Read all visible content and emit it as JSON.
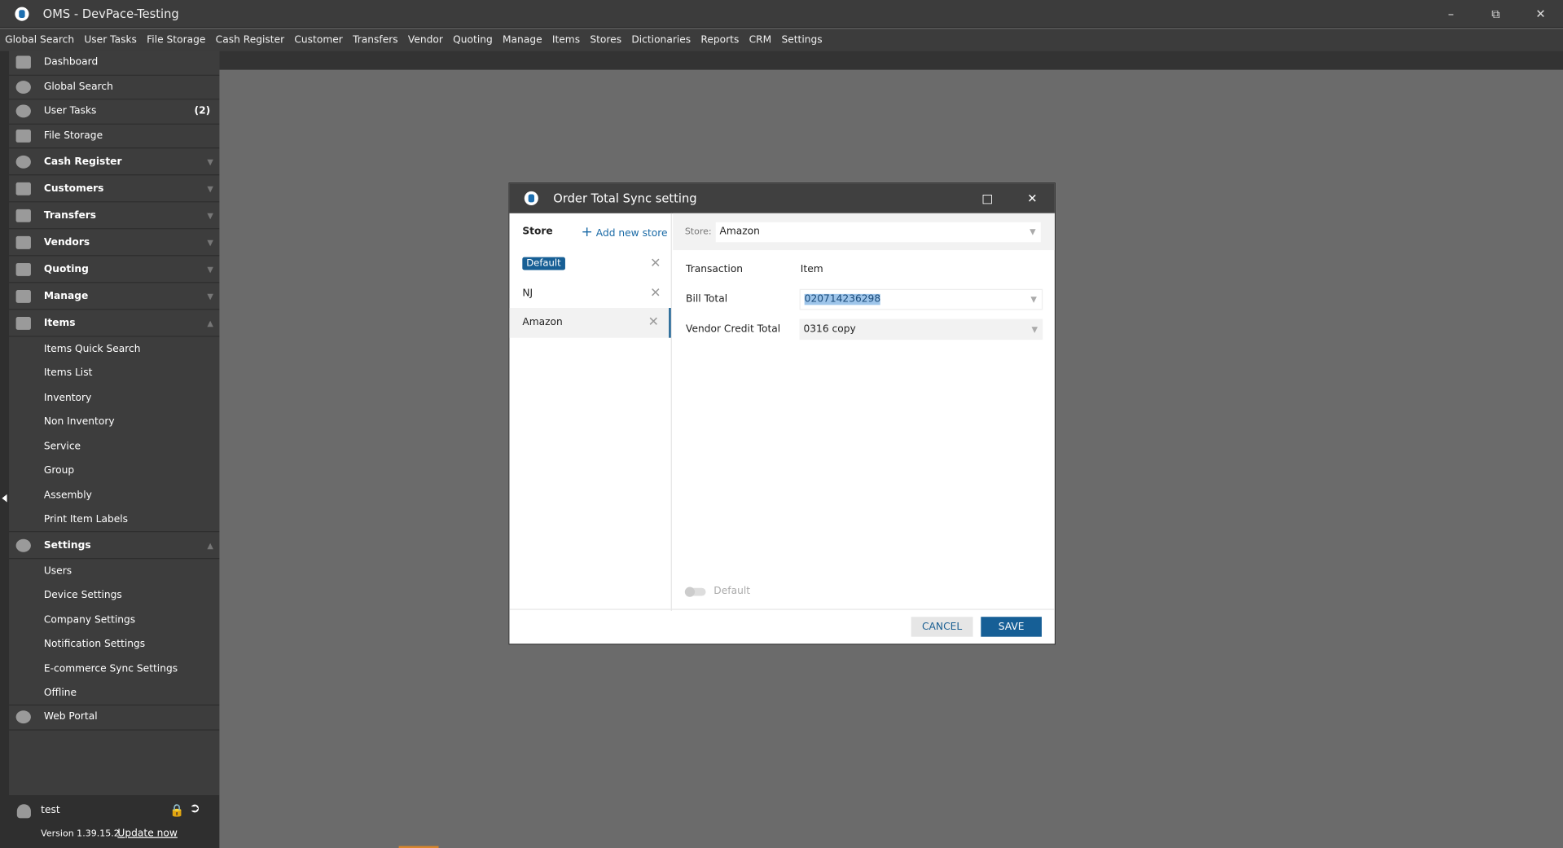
{
  "app": {
    "title": "OMS - DevPace-Testing",
    "window_controls": [
      "minimize",
      "restore",
      "close"
    ]
  },
  "menu": [
    "Global Search",
    "User Tasks",
    "File Storage",
    "Cash Register",
    "Customer",
    "Transfers",
    "Vendor",
    "Quoting",
    "Manage",
    "Items",
    "Stores",
    "Dictionaries",
    "Reports",
    "CRM",
    "Settings"
  ],
  "sidebar": {
    "items": [
      {
        "label": "Dashboard",
        "icon": "dashboard-icon"
      },
      {
        "label": "Global Search",
        "icon": "search-icon"
      },
      {
        "label": "User Tasks",
        "icon": "check-circle-icon",
        "badge": "(2)"
      },
      {
        "label": "File Storage",
        "icon": "folder-icon"
      },
      {
        "label": "Cash Register",
        "icon": "dollar-icon",
        "expandable": true
      },
      {
        "label": "Customers",
        "icon": "customer-icon",
        "expandable": true
      },
      {
        "label": "Transfers",
        "icon": "transfer-icon",
        "expandable": true
      },
      {
        "label": "Vendors",
        "icon": "vendor-icon",
        "expandable": true
      },
      {
        "label": "Quoting",
        "icon": "quoting-icon",
        "expandable": true
      },
      {
        "label": "Manage",
        "icon": "manage-icon",
        "expandable": true
      }
    ],
    "items_section": {
      "label": "Items",
      "children": [
        "Items Quick Search",
        "Items List",
        "Inventory",
        "Non Inventory",
        "Service",
        "Group",
        "Assembly",
        "Print Item Labels"
      ]
    },
    "settings_section": {
      "label": "Settings",
      "children": [
        "Users",
        "Device Settings",
        "Company Settings",
        "Notification Settings",
        "E-commerce Sync Settings",
        "Offline"
      ]
    },
    "web_portal": "Web Portal",
    "user": {
      "name": "test",
      "version": "Version 1.39.15.2",
      "update": "Update now"
    }
  },
  "dialog": {
    "title": "Order Total Sync setting",
    "store_header": "Store",
    "add_store": "Add new store",
    "stores": [
      {
        "label": "Default",
        "tag": true
      },
      {
        "label": "NJ"
      },
      {
        "label": "Amazon",
        "selected": true
      }
    ],
    "store_label": "Store:",
    "store_value": "Amazon",
    "col_transaction": "Transaction",
    "col_item": "Item",
    "rows": [
      {
        "transaction": "Bill Total",
        "item": "020714236298"
      },
      {
        "transaction": "Vendor Credit Total",
        "item": "0316 copy"
      }
    ],
    "default_toggle": "Default",
    "default_on": false,
    "cancel": "CANCEL",
    "save": "SAVE"
  },
  "colors": {
    "accent": "#165f96"
  }
}
